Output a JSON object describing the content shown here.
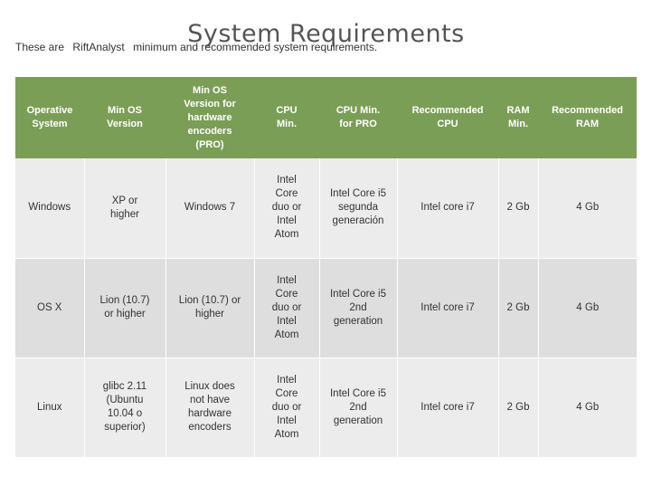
{
  "page": {
    "title": "System Requirements",
    "intro_prefix": "These are",
    "product_name": "RiftAnalyst",
    "intro_suffix": "minimum and recommended system requirements."
  },
  "table": {
    "headers": [
      "Operative\nSystem",
      "Min OS\nVersion",
      "Min OS\nVersion for\nhardware\nencoders\n(PRO)",
      "CPU\nMin.",
      "CPU Min.\nfor PRO",
      "Recommended\nCPU",
      "RAM\nMin.",
      "Recommended\nRAM"
    ],
    "rows": [
      {
        "os": "Windows",
        "min_os": "XP or\nhigher",
        "min_os_pro": "Windows 7",
        "cpu_min": "Intel\nCore\nduo or\nIntel\nAtom",
        "cpu_min_pro": "Intel Core i5\nsegunda\ngeneración",
        "rec_cpu": "Intel core i7",
        "ram_min": "2 Gb",
        "rec_ram": "4 Gb"
      },
      {
        "os": "OS X",
        "min_os": "Lion (10.7)\nor higher",
        "min_os_pro": "Lion (10.7) or\nhigher",
        "cpu_min": "Intel\nCore\nduo or\nIntel\nAtom",
        "cpu_min_pro": "Intel Core i5\n2nd\ngeneration",
        "rec_cpu": "Intel core i7",
        "ram_min": "2 Gb",
        "rec_ram": "4 Gb"
      },
      {
        "os": "Linux",
        "min_os": "glibc 2.11\n(Ubuntu\n10.04 o\nsuperior)",
        "min_os_pro": "Linux does\nnot have\nhardware\nencoders",
        "cpu_min": "Intel\nCore\nduo or\nIntel\nAtom",
        "cpu_min_pro": "Intel Core i5\n2nd\ngeneration",
        "rec_cpu": "Intel core i7",
        "ram_min": "2 Gb",
        "rec_ram": "4 Gb"
      }
    ]
  },
  "colors": {
    "header_bg": "#7b9e57",
    "row_light": "#ececec",
    "row_dark": "#dedede"
  }
}
